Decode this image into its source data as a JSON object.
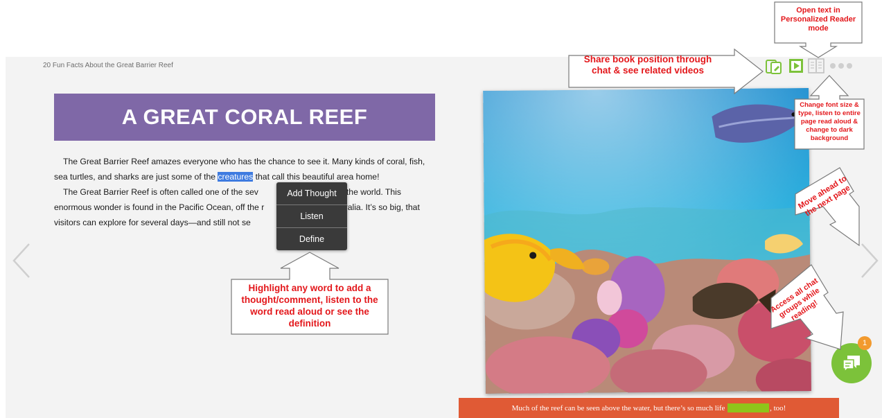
{
  "book": {
    "title": "20 Fun Facts About the Great Barrier Reef",
    "heading": "A GREAT CORAL REEF",
    "para1_a": "The Great Barrier Reef amazes everyone who has the chance to see it. Many kinds of coral, fish, sea turtles, and sharks are just some of the ",
    "para1_highlight": "creatures",
    "para1_b": " that call this beautiful area home!",
    "para2_a": "The Great Barrier Reef is often called one of the sev",
    "para2_b": "rs of the world. This enormous wonder is found in the Pacific Ocean, off the r",
    "para2_c": "Australia. It’s so big, that visitors can explore for several days—and still not se",
    "caption_a": "Much of the reef can be seen above the water, but there’s so much life",
    "caption_b": ", too!"
  },
  "context_menu": {
    "add_thought": "Add Thought",
    "listen": "Listen",
    "define": "Define"
  },
  "chat": {
    "badge_count": "1"
  },
  "annotations": {
    "open_text": "Open text in Personalized Reader mode",
    "share": "Share book position through chat & see related videos",
    "font_size": "Change font size & type, listen to entire page read aloud & change to dark background",
    "next_page": "Move ahead to the next page",
    "chat_groups": "Access all chat groups while reading!",
    "highlight": "Highlight any word to add a thought/comment, listen to the word read aloud or see the definition"
  },
  "colors": {
    "heading_banner": "#7f68a7",
    "highlight": "#3e7be0",
    "caption_bar": "#e05a35",
    "chat_button": "#7cc23a",
    "badge": "#f29a2e",
    "annotation_text": "#e3171b"
  },
  "icons": [
    "share-position-icon",
    "related-videos-icon",
    "reader-mode-icon",
    "more-options-icon",
    "chat-icon",
    "prev-page-icon",
    "next-page-icon"
  ]
}
